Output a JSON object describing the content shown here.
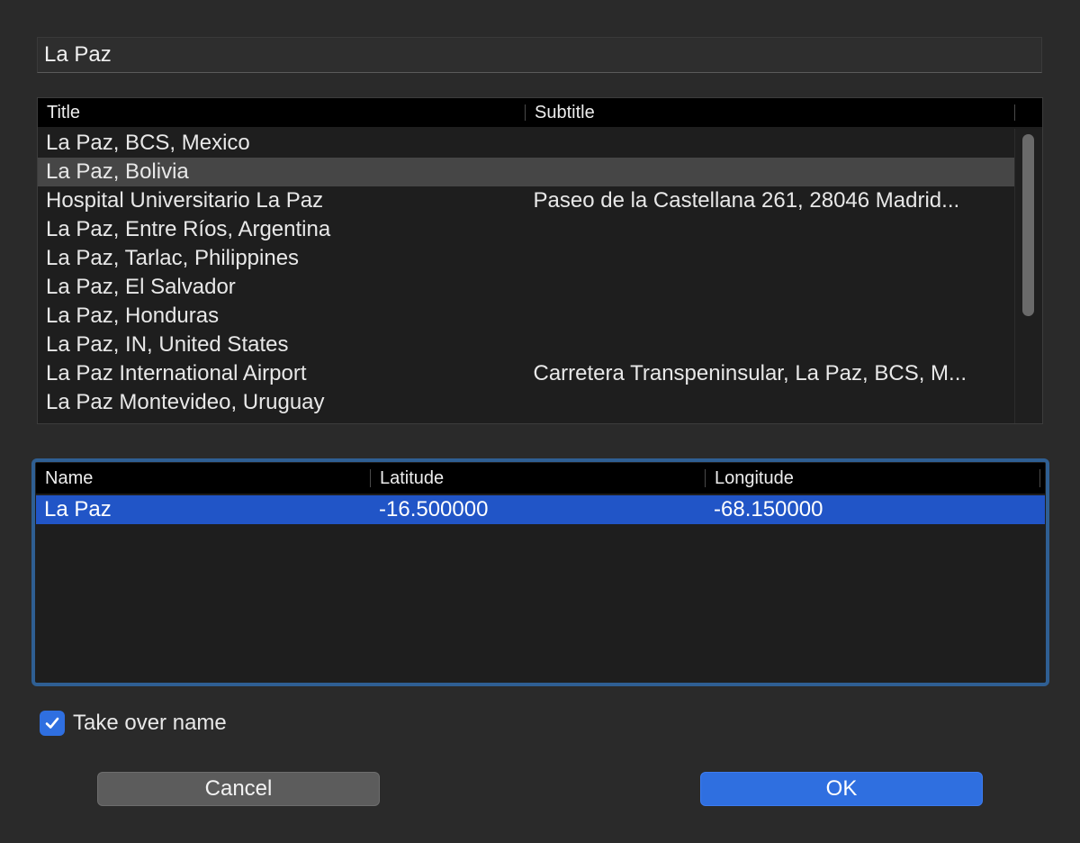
{
  "search": {
    "value": "La Paz"
  },
  "results": {
    "columns": [
      "Title",
      "Subtitle"
    ],
    "rows": [
      {
        "title": "La Paz, BCS, Mexico",
        "subtitle": ""
      },
      {
        "title": "La Paz, Bolivia",
        "subtitle": "",
        "selected": true
      },
      {
        "title": "Hospital Universitario La Paz",
        "subtitle": "Paseo de la Castellana 261, 28046 Madrid..."
      },
      {
        "title": "La Paz, Entre Ríos, Argentina",
        "subtitle": ""
      },
      {
        "title": "La Paz, Tarlac, Philippines",
        "subtitle": ""
      },
      {
        "title": "La Paz, El Salvador",
        "subtitle": ""
      },
      {
        "title": "La Paz, Honduras",
        "subtitle": ""
      },
      {
        "title": "La Paz, IN, United States",
        "subtitle": ""
      },
      {
        "title": "La Paz International Airport",
        "subtitle": "Carretera Transpeninsular, La Paz, BCS, M..."
      },
      {
        "title": "La Paz Montevideo, Uruguay",
        "subtitle": ""
      }
    ]
  },
  "coords": {
    "columns": [
      "Name",
      "Latitude",
      "Longitude"
    ],
    "row": {
      "name": "La Paz",
      "latitude": "-16.500000",
      "longitude": "-68.150000"
    }
  },
  "options": {
    "take_over_name_label": "Take over name",
    "take_over_name_checked": true
  },
  "buttons": {
    "cancel": "Cancel",
    "ok": "OK"
  },
  "colors": {
    "accent": "#2f6fe0",
    "selection_blue": "#2155c7",
    "focus_ring": "#2f5f93"
  }
}
